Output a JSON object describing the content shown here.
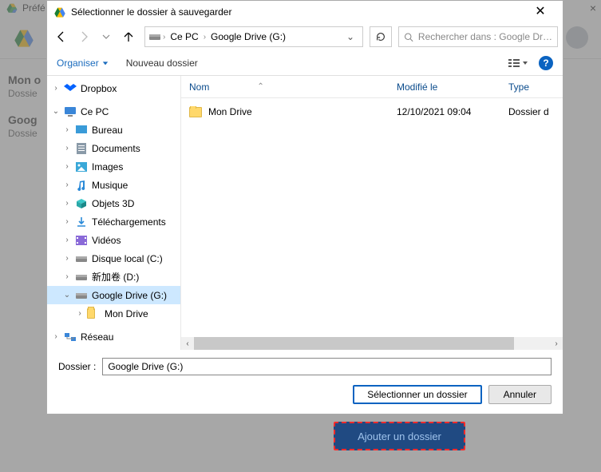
{
  "bg": {
    "pref_label": "Préfé",
    "close": "×",
    "item1": "Mon o",
    "item1s": "Dossie",
    "item2": "Goog",
    "item2s": "Dossie"
  },
  "dialog": {
    "title": "Sélectionner le dossier à sauvegarder",
    "close": "✕"
  },
  "breadcrumb": {
    "seg1": "Ce PC",
    "seg2": "Google Drive (G:)"
  },
  "search": {
    "placeholder": "Rechercher dans : Google Dr…"
  },
  "toolbar": {
    "organize": "Organiser",
    "new_folder": "Nouveau dossier"
  },
  "tree": {
    "dropbox": "Dropbox",
    "cepc": "Ce PC",
    "bureau": "Bureau",
    "documents": "Documents",
    "images": "Images",
    "musique": "Musique",
    "objets3d": "Objets 3D",
    "telechargements": "Téléchargements",
    "videos": "Vidéos",
    "disque_c": "Disque local (C:)",
    "xinjia": "新加卷 (D:)",
    "gdrive": "Google Drive (G:)",
    "mondrive": "Mon Drive",
    "reseau": "Réseau"
  },
  "cols": {
    "name": "Nom",
    "modified": "Modifié le",
    "type": "Type"
  },
  "files": [
    {
      "name": "Mon Drive",
      "modified": "12/10/2021 09:04",
      "type": "Dossier d"
    }
  ],
  "bottom": {
    "label": "Dossier :",
    "value": "Google Drive (G:)",
    "select": "Sélectionner un dossier",
    "cancel": "Annuler"
  },
  "addbtn": "Ajouter un dossier"
}
